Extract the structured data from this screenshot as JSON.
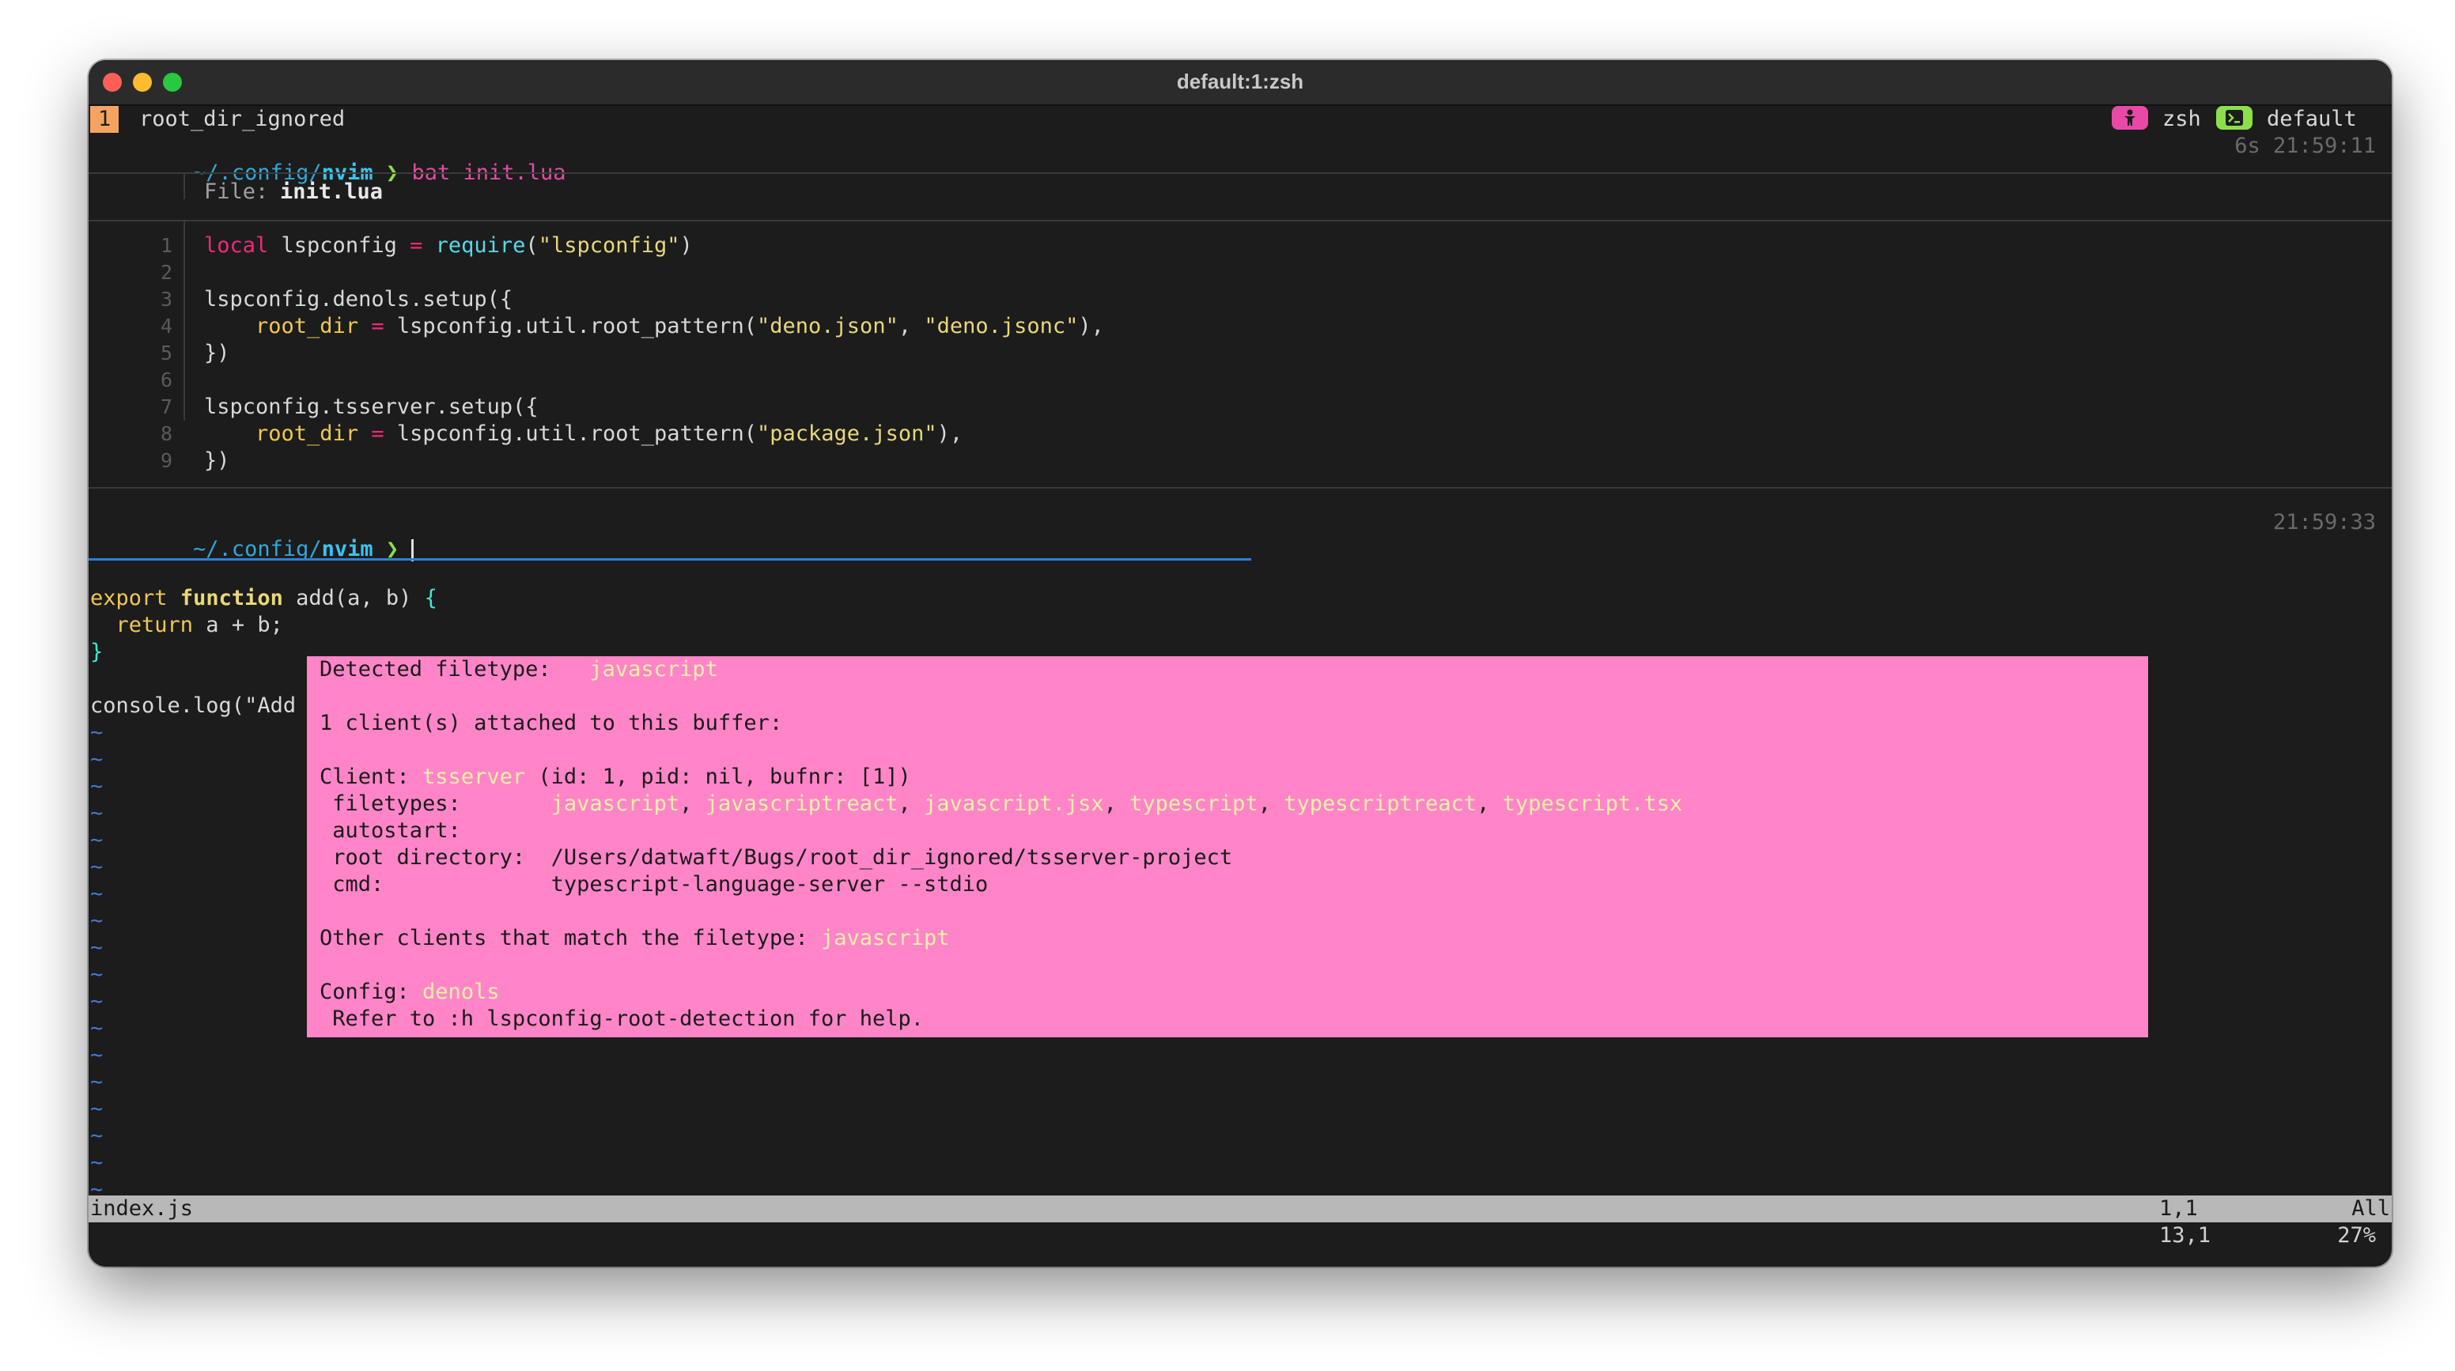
{
  "window": {
    "title": "default:1:zsh"
  },
  "tmux": {
    "window_number": "1",
    "window_name": "root_dir_ignored",
    "right_zsh_label": "zsh",
    "right_session_label": "default",
    "zsh_pill_color": "#e64aa6",
    "session_pill_color": "#8be04a"
  },
  "prompt1": {
    "path_prefix": "~/.config/",
    "path_dir": "nvim",
    "arrow": "❯",
    "command": "bat init.lua",
    "duration_time": "6s 21:59:11"
  },
  "bat": {
    "file_label": "File: ",
    "file_name": "init.lua",
    "line_numbers": [
      "1",
      "2",
      "3",
      "4",
      "5",
      "6",
      "7",
      "8",
      "9"
    ]
  },
  "prompt2": {
    "path_prefix": "~/.config/",
    "path_dir": "nvim",
    "arrow": "❯",
    "time": "21:59:33"
  },
  "editor": {
    "code": {
      "l1_export": "export",
      "l1_function": "function",
      "l1_rest": " add(a, b) ",
      "l1_brace": "{",
      "l2_return": "  return",
      "l2_rest": " a + b;",
      "l3_brace": "}",
      "l5_text": "console.log(\"Add"
    },
    "tilde": "~"
  },
  "popup": {
    "detected_label": "Detected filetype:   ",
    "detected_value": "javascript",
    "clients_attached": "1 client(s) attached to this buffer:",
    "client_label": "Client: ",
    "client_name": "tsserver",
    "client_info": " (id: 1, pid: nil, bufnr: [1])",
    "filetypes_label": " filetypes:       ",
    "filetypes": [
      "javascript",
      "javascriptreact",
      "javascript.jsx",
      "typescript",
      "typescriptreact",
      "typescript.tsx"
    ],
    "filetypes_sep": ", ",
    "autostart_label": " autostart:",
    "root_label": " root directory:  ",
    "root_value": "/Users/datwaft/Bugs/root_dir_ignored/tsserver-project",
    "cmd_label": " cmd:             ",
    "cmd_value": "typescript-language-server --stdio",
    "other_label": "Other clients that match the filetype: ",
    "other_value": "javascript",
    "config_label": "Config: ",
    "config_value": "denols",
    "refer_text": " Refer to :h lspconfig-root-detection for help."
  },
  "statusline": {
    "filename": "index.js",
    "position": "1,1",
    "scroll": "All"
  },
  "cmdline": {
    "position": "13,1",
    "percent": "27%"
  }
}
